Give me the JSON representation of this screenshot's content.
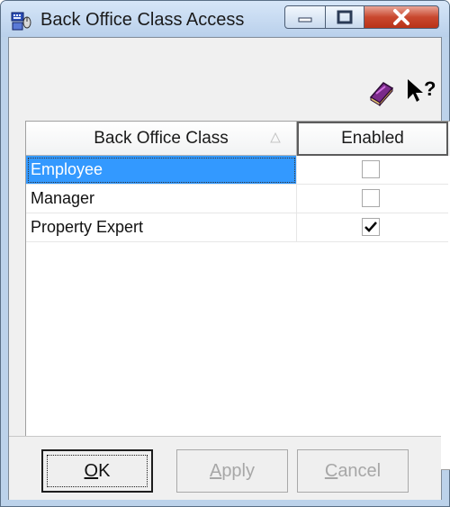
{
  "window": {
    "title": "Back Office Class Access",
    "app_icon": "keyboard-mouse-icon",
    "caption_buttons": [
      "minimize-icon",
      "maximize-icon",
      "close-icon"
    ]
  },
  "toolbar": {
    "icons": [
      "book-icon",
      "help-pointer-icon"
    ]
  },
  "grid": {
    "columns": [
      "Back Office Class",
      "Enabled"
    ],
    "sort_indicator": "sort-ascending-icon",
    "rows": [
      {
        "name": "Employee",
        "enabled": false,
        "selected": true
      },
      {
        "name": "Manager",
        "enabled": false,
        "selected": false
      },
      {
        "name": "Property Expert",
        "enabled": true,
        "selected": false
      }
    ]
  },
  "buttons": {
    "ok": {
      "mnemonic": "O",
      "rest": "K",
      "enabled": true
    },
    "apply": {
      "mnemonic": "A",
      "rest": "pply",
      "enabled": false
    },
    "cancel": {
      "mnemonic": "C",
      "rest": "ancel",
      "enabled": false
    }
  },
  "colors": {
    "selection": "#3399ff",
    "close_button": "#c9482f"
  }
}
